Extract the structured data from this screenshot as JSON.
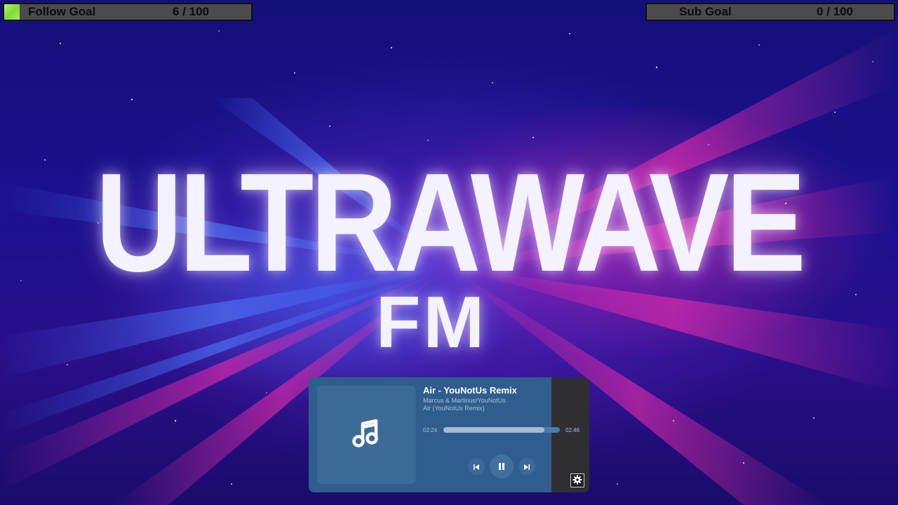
{
  "goals": {
    "follow": {
      "label": "Follow Goal",
      "count": "6 / 100",
      "progress": 0.06,
      "color": "#8fe04a"
    },
    "sub": {
      "label": "Sub Goal",
      "count": "0 / 100",
      "progress": 0.0,
      "color": "#8fe04a"
    }
  },
  "branding": {
    "title": "ULTRAWAVE",
    "subtitle": "FM"
  },
  "player": {
    "track_title": "Air - YouNotUs Remix",
    "artist": "Marcus & Martinus/YouNotUs",
    "album": "Air (YouNotUs Remix)",
    "current_time": "02:24",
    "total_time": "02:46",
    "progress": 0.87,
    "album_art_icon": "music-note-icon",
    "controls": [
      "previous-icon",
      "pause-icon",
      "next-icon"
    ],
    "settings_icon": "gear-icon"
  },
  "colors": {
    "accent": "#8fe04a",
    "player_bg": "#2f5d8e",
    "glow_pink": "#ff2aa8",
    "glow_blue": "#4a6cff"
  }
}
